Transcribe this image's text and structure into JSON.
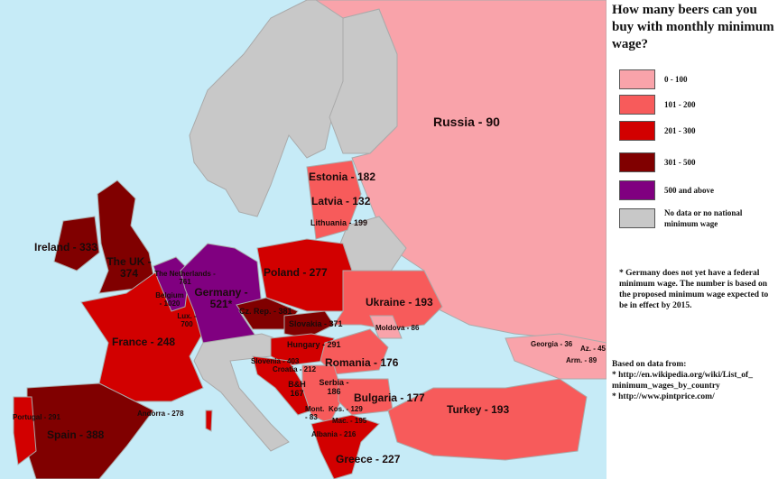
{
  "title": "How many beers can you buy with monthly minimum wage?",
  "legend": [
    {
      "label": "0 - 100",
      "color": "#f9a3aa"
    },
    {
      "label": "101 - 200",
      "color": "#f75b5b"
    },
    {
      "label": "201 - 300",
      "color": "#d20000"
    },
    {
      "label": "301 - 500",
      "color": "#800000"
    },
    {
      "label": "500 and above",
      "color": "#800080"
    },
    {
      "label": "No data or no national minimum wage",
      "color": "#c8c8c8"
    }
  ],
  "note": "* Germany does not yet have a federal minimum wage. The number is based on the proposed minimum wage expected to be in effect by 2015.",
  "sources": {
    "heading": "Based on data from:",
    "lines": [
      "* http://en.wikipedia.org/wiki/List_of_ minimum_wages_by_country",
      "* http://www.pintprice.com/"
    ]
  },
  "colors": {
    "sea": "#c6ebf7"
  },
  "labels": {
    "russia": "Russia - 90",
    "estonia": "Estonia - 182",
    "latvia": "Latvia - 132",
    "lithuania": "Lithuania - 199",
    "ireland": "Ireland - 333",
    "uk": "The UK - 374",
    "netherlands": "The Netherlands - 761",
    "belgium": "Belgium - 1020",
    "lux": "Lux. - 700",
    "germany": "Germany - 521*",
    "poland": "Poland - 277",
    "czech": "Cz. Rep. - 381",
    "slovakia": "Slovakia - 371",
    "ukraine": "Ukraine - 193",
    "moldova": "Moldova - 86",
    "hungary": "Hungary - 291",
    "france": "France - 248",
    "slovenia": "Slovenia - 403",
    "croatia": "Croatia - 212",
    "romania": "Romania - 176",
    "serbia": "Serbia - 186",
    "bh": "B&H 167",
    "bulgaria": "Bulgaria - 177",
    "turkey": "Turkey - 193",
    "georgia": "Georgia - 36",
    "azerbaijan": "Az. - 45",
    "armenia": "Arm. - 89",
    "portugal": "Portugal - 291",
    "spain": "Spain - 388",
    "andorra": "Andorra - 278",
    "montenegro": "Mont. - 83",
    "kosovo": "Kos. - 129",
    "macedonia": "Mac. - 195",
    "albania": "Albania - 216",
    "greece": "Greece - 227"
  }
}
